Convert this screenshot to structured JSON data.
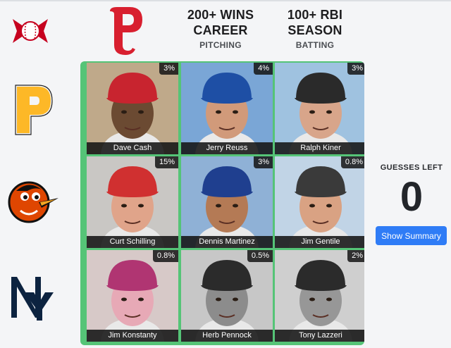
{
  "columns": [
    {
      "main_line1": "",
      "main_line2": "",
      "sub": "",
      "logo": "phillies-p-logo"
    },
    {
      "main_line1": "200+ WINS",
      "main_line2": "CAREER",
      "sub": "PITCHING"
    },
    {
      "main_line1": "100+ RBI",
      "main_line2": "SEASON",
      "sub": "BATTING"
    }
  ],
  "rows": [
    {
      "logo": "reds-logo"
    },
    {
      "logo": "pirates-p-logo"
    },
    {
      "logo": "orioles-bird-logo"
    },
    {
      "logo": "yankees-ny-logo"
    }
  ],
  "cells": [
    {
      "name": "Dave Cash",
      "pct": "3%",
      "cap": "#c8242f",
      "skin": "#6b4a32",
      "bg": "#bfa98a"
    },
    {
      "name": "Jerry Reuss",
      "pct": "4%",
      "cap": "#1e4fa5",
      "skin": "#d19a7a",
      "bg": "#7aa6d6"
    },
    {
      "name": "Ralph Kiner",
      "pct": "3%",
      "cap": "#2a2a2a",
      "skin": "#d8a58a",
      "bg": "#9fc2e0"
    },
    {
      "name": "Curt Schilling",
      "pct": "15%",
      "cap": "#d03030",
      "skin": "#e0a48a",
      "bg": "#c9c7c4"
    },
    {
      "name": "Dennis Martinez",
      "pct": "3%",
      "cap": "#1f3f8f",
      "skin": "#b47a55",
      "bg": "#8fb1d6"
    },
    {
      "name": "Jim Gentile",
      "pct": "0.8%",
      "cap": "#3a3a3a",
      "skin": "#d9a283",
      "bg": "#c1d4e6"
    },
    {
      "name": "Jim Konstanty",
      "pct": "0.8%",
      "cap": "#b03572",
      "skin": "#e7a9b6",
      "bg": "#d7c9c8"
    },
    {
      "name": "Herb Pennock",
      "pct": "0.5%",
      "cap": "#2b2b2b",
      "skin": "#8c8c8c",
      "bg": "#c7c7c7"
    },
    {
      "name": "Tony Lazzeri",
      "pct": "2%",
      "cap": "#2b2b2b",
      "skin": "#979797",
      "bg": "#cfcfcf"
    }
  ],
  "guesses": {
    "label": "GUESSES LEFT",
    "count": "0"
  },
  "summary_button": {
    "label": "Show Summary"
  },
  "colors": {
    "correct": "#55c477",
    "button": "#2f7cf6",
    "phillies_red": "#d81f2f",
    "pirates_gold": "#fdb827",
    "orioles_orange": "#df4601",
    "yankees_navy": "#0c2340",
    "reds_red": "#c6011f"
  }
}
